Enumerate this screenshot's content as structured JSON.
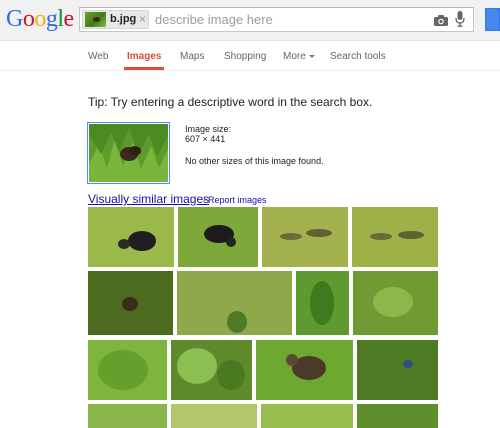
{
  "logo": {
    "letters": [
      "G",
      "o",
      "o",
      "g",
      "l",
      "e"
    ],
    "colors": [
      "#3369e8",
      "#d50f25",
      "#eeb211",
      "#3369e8",
      "#009925",
      "#d50f25"
    ]
  },
  "search": {
    "chip_label": "b.jpg",
    "chip_close": "×",
    "placeholder": "describe image here"
  },
  "nav": {
    "items": [
      {
        "label": "Web"
      },
      {
        "label": "Images",
        "active": true
      },
      {
        "label": "Maps"
      },
      {
        "label": "Shopping"
      },
      {
        "label": "More"
      },
      {
        "label": "Search tools"
      }
    ]
  },
  "tip": "Tip: Try entering a descriptive word in the search box.",
  "image_info": {
    "size_label": "Image size:",
    "size_value": "607 × 441",
    "no_sizes": "No other sizes of this image found."
  },
  "similar": {
    "link": "Visually similar images",
    "dash": "-",
    "report": "Report images"
  },
  "icons": {
    "camera": "camera-icon",
    "mic": "microphone-icon",
    "close": "close-icon",
    "caret": "caret-down-icon"
  },
  "colors": {
    "accent_red": "#dd4b39",
    "link_blue": "#1a0dab",
    "button_blue": "#4787ed"
  }
}
